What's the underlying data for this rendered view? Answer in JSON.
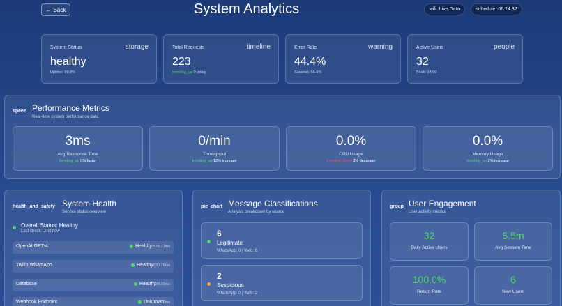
{
  "header": {
    "back_label": "Back",
    "title": "System Analytics",
    "live_icon": "wifi",
    "live_label": "Live Data",
    "time_icon": "schedule",
    "time": "06:24:32"
  },
  "kpis": [
    {
      "label": "System Status",
      "icon": "storage",
      "value": "healthy",
      "sub_prefix": "",
      "sub": "Uptime: 99.9%"
    },
    {
      "label": "Total Requests",
      "icon": "timeline",
      "value": "223",
      "sub_prefix": "trending_up",
      "sub": "0 today"
    },
    {
      "label": "Error Rate",
      "icon": "warning",
      "value": "44.4%",
      "sub_prefix": "",
      "sub": "Success: 55.6%"
    },
    {
      "label": "Active Users",
      "icon": "people",
      "value": "32",
      "sub_prefix": "",
      "sub": "Peak: 14:00"
    }
  ],
  "performance": {
    "icon": "speed",
    "title": "Performance Metrics",
    "subtitle": "Real-time system performance data",
    "metrics": [
      {
        "value": "3ms",
        "label": "Avg Response Time",
        "trend": "trending_up",
        "change": "5% faster",
        "trend_color": "#4cd964"
      },
      {
        "value": "0/min",
        "label": "Throughput",
        "trend": "trending_up",
        "change": "12% increase",
        "trend_color": "#4cd964"
      },
      {
        "value": "0.0%",
        "label": "CPU Usage",
        "trend": "trending_down",
        "change": "3% decrease",
        "trend_color": "#ff4d4d"
      },
      {
        "value": "0.0%",
        "label": "Memory Usage",
        "trend": "trending_up",
        "change": "2% increase",
        "trend_color": "#4cd964"
      }
    ]
  },
  "health": {
    "icon": "health_and_safety",
    "title": "System Health",
    "subtitle": "Service status overview",
    "overall": "Overall Status: Healthy",
    "last_check": "Last check: Just now",
    "services": [
      {
        "name": "OpenAI GPT-4",
        "status": "Healthy",
        "ms": "2538.37ms",
        "color": "#4cd964"
      },
      {
        "name": "Twilio WhatsApp",
        "status": "Healthy",
        "ms": "630.76ms",
        "color": "#4cd964"
      },
      {
        "name": "Database",
        "status": "Healthy",
        "ms": "38.23ms",
        "color": "#4cd964"
      },
      {
        "name": "Webhook Endpoint",
        "status": "Unknown",
        "ms": "0ms",
        "color": "#4cd964"
      }
    ]
  },
  "classifications": {
    "icon": "pie_chart",
    "title": "Message Classifications",
    "subtitle": "Analysis breakdown by source",
    "items": [
      {
        "count": "6",
        "label": "Legitimate",
        "source": "WhatsApp: 0 | Web: 6",
        "color": "#4cd964"
      },
      {
        "count": "2",
        "label": "Suspicious",
        "source": "WhatsApp: 0 | Web: 2",
        "color": "#ff9f2e"
      }
    ]
  },
  "engagement": {
    "icon": "group",
    "title": "User Engagement",
    "subtitle": "User activity metrics",
    "stats": [
      {
        "value": "32",
        "label": "Daily Active Users"
      },
      {
        "value": "5.5m",
        "label": "Avg Session Time"
      },
      {
        "value": "100.0%",
        "label": "Return Rate"
      },
      {
        "value": "6",
        "label": "New Users"
      }
    ]
  }
}
